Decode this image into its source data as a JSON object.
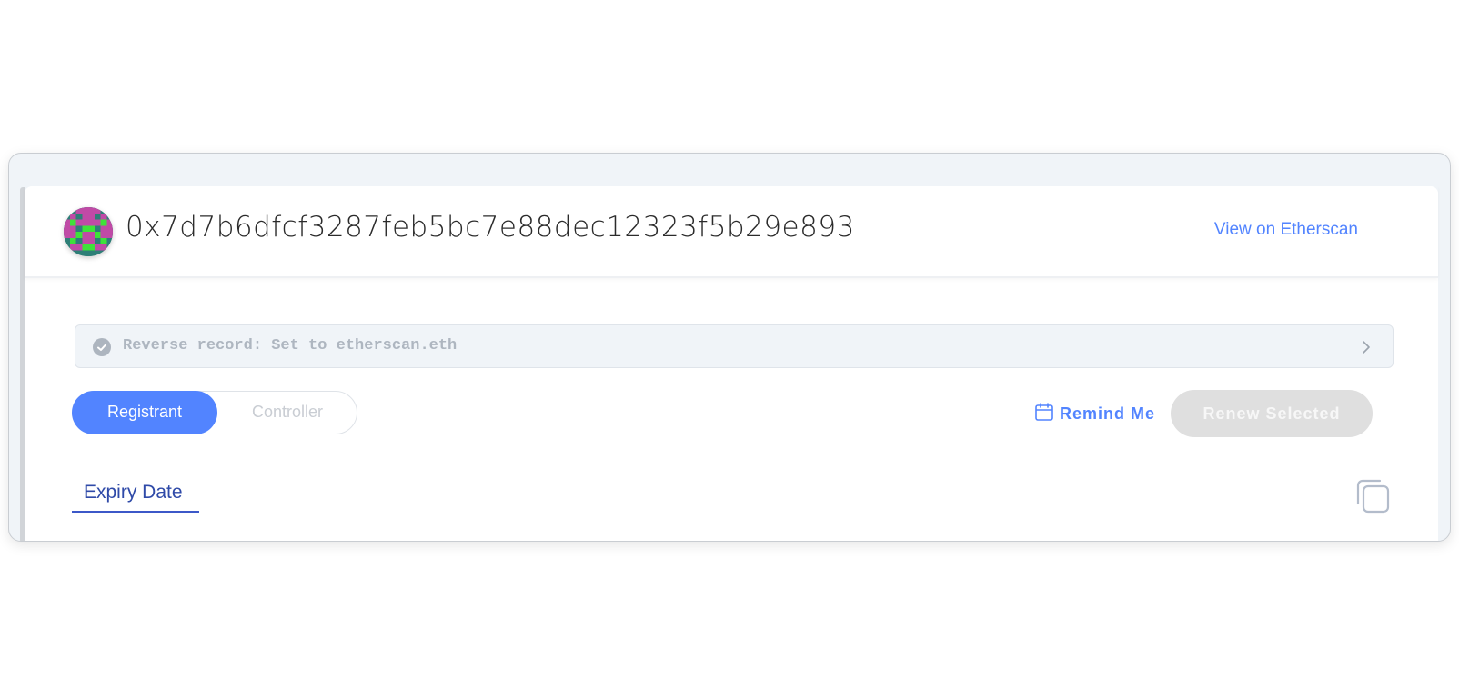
{
  "account": {
    "address": "0x7d7b6dfcf3287feb5bc7e88dec12323f5b29e893",
    "avatar_icon": "identicon-avatar"
  },
  "header": {
    "etherscan_link_label": "View on Etherscan"
  },
  "reverse_record": {
    "text": "Reverse record: Set to etherscan.eth",
    "status_icon": "check-circle-icon",
    "expand_icon": "chevron-right-icon"
  },
  "role_toggle": {
    "options": [
      "Registrant",
      "Controller"
    ],
    "selected": "Registrant"
  },
  "actions": {
    "remind_me_label": "Remind Me",
    "remind_me_icon": "calendar-icon",
    "renew_label": "Renew Selected",
    "copy_icon": "copy-icon"
  },
  "tabs": {
    "expiry_date_label": "Expiry Date"
  },
  "colors": {
    "accent": "#5284ff",
    "tab_text": "#2f4aa8",
    "disabled_button": "#dfdfdf",
    "panel_background": "#f0f4f8"
  }
}
